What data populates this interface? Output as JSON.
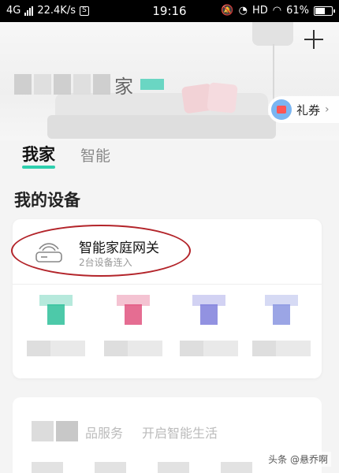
{
  "status_bar": {
    "network": "4G",
    "speed": "22.4K/s",
    "s_badge": "S",
    "time": "19:16",
    "hd": "HD",
    "battery_text": "61%",
    "battery_fraction": 0.61
  },
  "header": {
    "home_name_suffix": "家",
    "coupon_label": "礼券",
    "coupon_chevron": "›"
  },
  "tabs": [
    {
      "label": "我家",
      "active": true
    },
    {
      "label": "智能",
      "active": false
    }
  ],
  "devices_section": {
    "title": "我的设备",
    "gateway": {
      "name": "智能家庭网关",
      "subtitle": "2台设备连入"
    },
    "devices": [
      {
        "color": "#2ebf9a"
      },
      {
        "color": "#e0537f"
      },
      {
        "color": "#7f7fdc"
      },
      {
        "color": "#8a95e0"
      }
    ]
  },
  "second_card": {
    "text_a": "品服务",
    "text_b": "开启智能生活"
  },
  "watermark": "头条 @悬乔啊",
  "colors": {
    "accent": "#2ecfae",
    "annotation": "#b3242a"
  }
}
